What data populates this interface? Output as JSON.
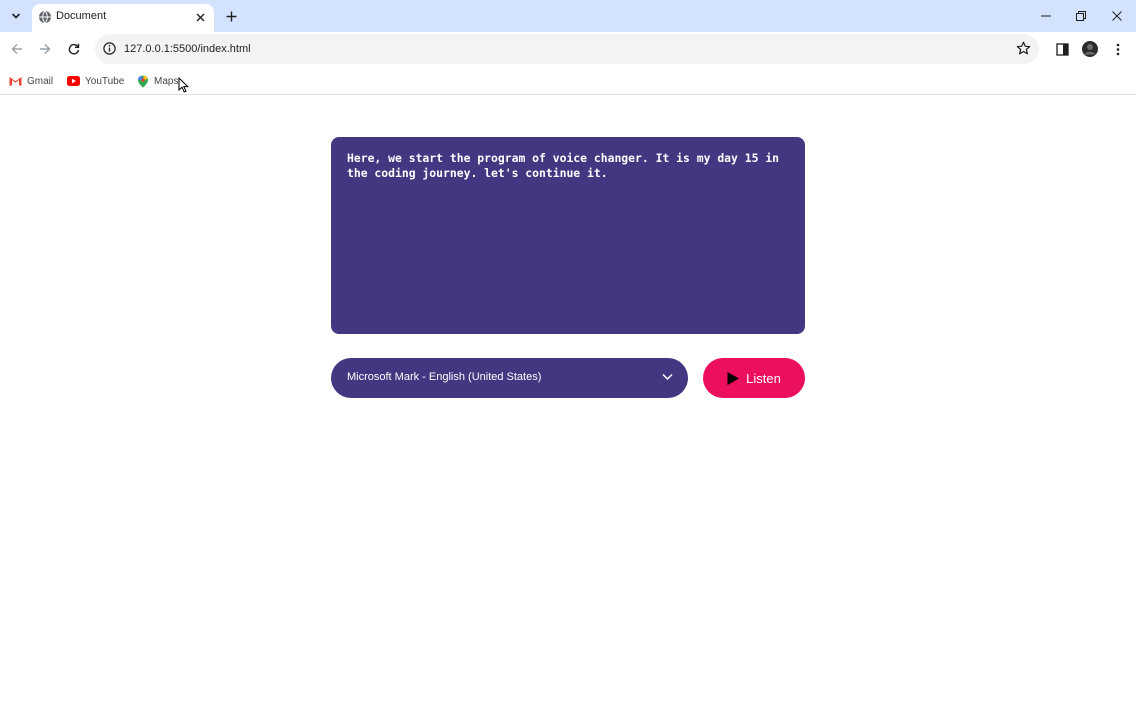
{
  "browser": {
    "tab": {
      "title": "Document"
    },
    "address_bar": {
      "url": "127.0.0.1:5500/index.html"
    },
    "bookmarks": [
      {
        "label": "Gmail",
        "icon": "gmail-icon"
      },
      {
        "label": "YouTube",
        "icon": "youtube-icon"
      },
      {
        "label": "Maps",
        "icon": "maps-icon"
      }
    ]
  },
  "app": {
    "textarea_value": "Here, we start the program of voice changer. It is my day 15 in the coding journey. let's continue it.",
    "voice_select": {
      "selected": "Microsoft Mark - English (United States)"
    },
    "listen_button": {
      "label": "Listen"
    }
  },
  "colors": {
    "panel": "#433781",
    "accent": "#ec0f5d",
    "titlebar": "#d3e3fd"
  }
}
